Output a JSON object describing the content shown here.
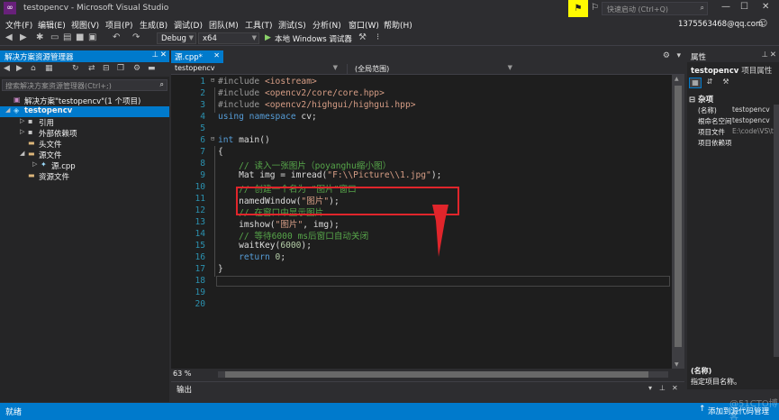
{
  "window": {
    "title": "testopencv - Microsoft Visual Studio",
    "quick_launch_placeholder": "快速启动 (Ctrl+Q)",
    "account": "1375563468@qq.com"
  },
  "menu": [
    "文件(F)",
    "编辑(E)",
    "视图(V)",
    "项目(P)",
    "生成(B)",
    "调试(D)",
    "团队(M)",
    "工具(T)",
    "测试(S)",
    "分析(N)",
    "窗口(W)",
    "帮助(H)"
  ],
  "toolbar": {
    "config": "Debug",
    "platform": "x64",
    "run_label": "本地 Windows 调试器",
    "run_dropdown": "▾"
  },
  "solution_explorer": {
    "title": "解决方案资源管理器",
    "search_placeholder": "搜索解决方案资源管理器(Ctrl+;)",
    "items": [
      {
        "label": "解决方案\"testopencv\"(1 个项目)",
        "level": 0,
        "icon": "solution-icon",
        "expander": ""
      },
      {
        "label": "testopencv",
        "level": 0,
        "icon": "project-icon",
        "expander": "◢",
        "selected": true
      },
      {
        "label": "引用",
        "level": 1,
        "icon": "references-icon",
        "expander": "▷"
      },
      {
        "label": "外部依赖项",
        "level": 1,
        "icon": "external-deps-icon",
        "expander": "▷"
      },
      {
        "label": "头文件",
        "level": 1,
        "icon": "folder-icon",
        "expander": ""
      },
      {
        "label": "源文件",
        "level": 1,
        "icon": "folder-open-icon",
        "expander": "◢"
      },
      {
        "label": "源.cpp",
        "level": 2,
        "icon": "cpp-file-icon",
        "expander": "▷"
      },
      {
        "label": "资源文件",
        "level": 1,
        "icon": "folder-icon",
        "expander": ""
      }
    ]
  },
  "editor": {
    "tab_label": "源.cpp*",
    "nav_project": "testopencv",
    "nav_scope": "(全局范围)",
    "zoom": "63 %",
    "line_numbers": [
      "1",
      "2",
      "3",
      "4",
      "5",
      "6",
      "7",
      "8",
      "9",
      "10",
      "11",
      "12",
      "13",
      "14",
      "15",
      "16",
      "17",
      "18",
      "19",
      "20"
    ]
  },
  "output_panel": {
    "label": "输出"
  },
  "properties": {
    "title": "属性",
    "object": "testopencv",
    "object_type": "项目属性",
    "category": "杂项",
    "rows": [
      {
        "key": "(名称)",
        "value": "testopencv"
      },
      {
        "key": "根命名空间",
        "value": "testopencv"
      },
      {
        "key": "项目文件",
        "value": "E:\\code\\VS\\t"
      },
      {
        "key": "项目依赖项",
        "value": ""
      }
    ],
    "desc_title": "(名称)",
    "desc_text": "指定项目名称。"
  },
  "status": {
    "ready": "就绪",
    "source_control": "添加到源代码管理",
    "watermark": "@51CTO博客"
  },
  "colors": {
    "accent": "#007acc",
    "highlight_box": "#e0252b",
    "notification": "#fffb00"
  }
}
